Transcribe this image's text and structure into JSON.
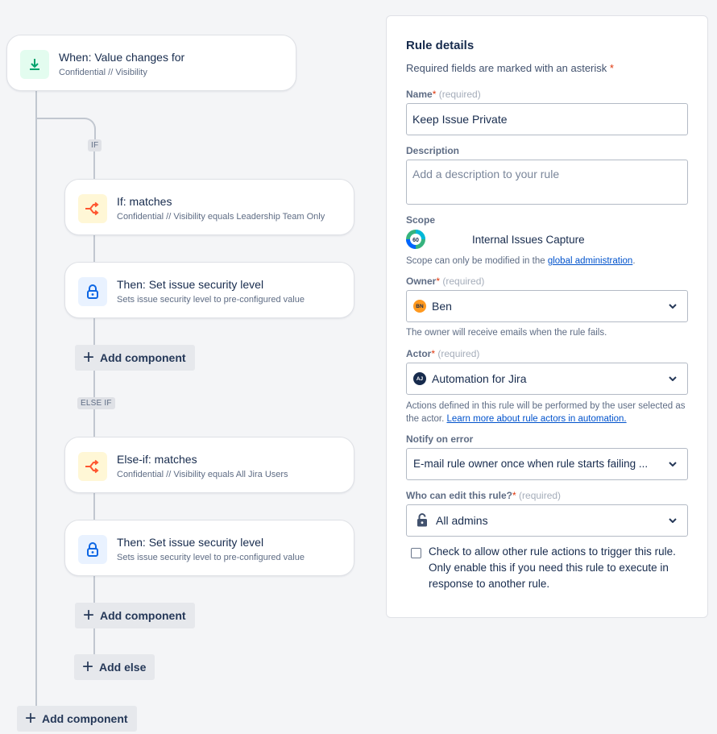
{
  "colors": {
    "trigger_bg": "#e3fcef",
    "trigger_icon": "#00a36c",
    "condition_bg": "#fff7d6",
    "condition_icon": "#ff5630",
    "action_bg": "#e9f2ff",
    "action_icon": "#0c66e4",
    "required": "#de350b",
    "link": "#0052cc"
  },
  "flow": {
    "trigger": {
      "title": "When: Value changes for",
      "subtitle": "Confidential // Visibility",
      "icon": "download-arrow-icon"
    },
    "if_tag": "IF",
    "if_condition": {
      "title": "If: matches",
      "subtitle": "Confidential // Visibility equals Leadership Team Only",
      "icon": "branch-icon"
    },
    "if_action": {
      "title": "Then: Set issue security level",
      "subtitle": "Sets issue security level to pre-configured value",
      "icon": "lock-icon"
    },
    "add_component_1": "Add component",
    "else_if_tag": "ELSE IF",
    "else_condition": {
      "title": "Else-if: matches",
      "subtitle": "Confidential // Visibility equals All Jira Users",
      "icon": "branch-icon"
    },
    "else_action": {
      "title": "Then: Set issue security level",
      "subtitle": "Sets issue security level to pre-configured value",
      "icon": "lock-icon"
    },
    "add_component_2": "Add component",
    "add_else": "Add else",
    "add_component_3": "Add component"
  },
  "panel": {
    "title": "Rule details",
    "required_note": "Required fields are marked with an asterisk",
    "asterisk": "*",
    "required_hint": "(required)",
    "name_label": "Name",
    "name_value": "Keep Issue Private",
    "description_label": "Description",
    "description_placeholder": "Add a description to your rule",
    "scope_label": "Scope",
    "scope_value": "Internal Issues Capture",
    "scope_help_prefix": "Scope can only be modified in the",
    "scope_help_link": "global administration",
    "scope_help_suffix": ".",
    "owner_label": "Owner",
    "owner_initials": "BN",
    "owner_value": "Ben",
    "owner_help": "The owner will receive emails when the rule fails.",
    "actor_label": "Actor",
    "actor_initials": "AJ",
    "actor_value": "Automation for Jira",
    "actor_help_prefix": "Actions defined in this rule will be performed by the user selected as the actor.",
    "actor_help_link": "Learn more about rule actors in automation.",
    "notify_label": "Notify on error",
    "notify_value": "E-mail rule owner once when rule starts failing ...",
    "edit_label": "Who can edit this rule?",
    "edit_value": "All admins",
    "checkbox_label": "Check to allow other rule actions to trigger this rule. Only enable this if you need this rule to execute in response to another rule."
  }
}
